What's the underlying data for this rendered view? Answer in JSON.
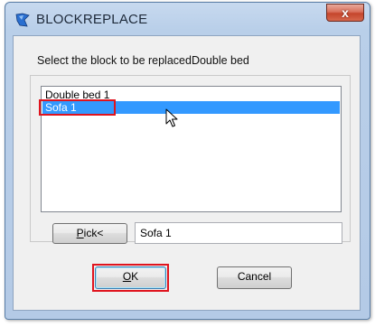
{
  "window": {
    "title": "BLOCKREPLACE",
    "close_label": "x"
  },
  "prompt": "Select the block to be replacedDouble bed",
  "list": {
    "items": [
      {
        "label": "Double bed 1",
        "selected": false
      },
      {
        "label": "Sofa 1",
        "selected": true
      }
    ]
  },
  "pick": {
    "label_underlined": "P",
    "label_rest": "ick<",
    "field_value": "Sofa 1"
  },
  "buttons": {
    "ok_underlined": "O",
    "ok_rest": "K",
    "cancel": "Cancel"
  },
  "colors": {
    "selection": "#3399ff",
    "highlight_box": "#e0141e",
    "title_bar": "#b9cfe9"
  },
  "icons": {
    "app": "gstarcad-icon",
    "close": "close-icon",
    "cursor": "mouse-pointer-icon"
  }
}
